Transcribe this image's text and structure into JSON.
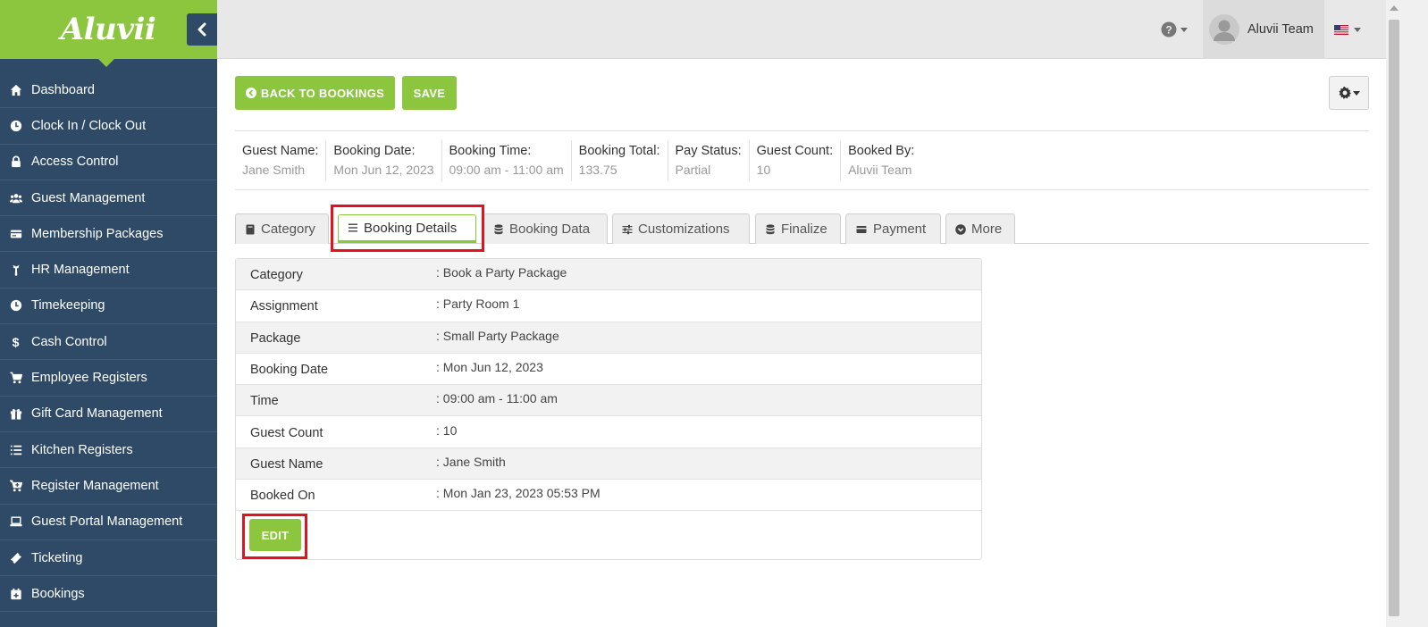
{
  "brand": {
    "logo_text": "Aluvii",
    "accent": "#8cc63f",
    "sidebar_bg": "#2e4a66"
  },
  "sidebar": {
    "items": [
      {
        "label": "Dashboard",
        "icon": "home-icon"
      },
      {
        "label": "Clock In / Clock Out",
        "icon": "clock-icon"
      },
      {
        "label": "Access Control",
        "icon": "lock-icon"
      },
      {
        "label": "Guest Management",
        "icon": "users-icon"
      },
      {
        "label": "Membership Packages",
        "icon": "card-icon"
      },
      {
        "label": "HR Management",
        "icon": "person-tie-icon"
      },
      {
        "label": "Timekeeping",
        "icon": "clock-icon"
      },
      {
        "label": "Cash Control",
        "icon": "dollar-icon"
      },
      {
        "label": "Employee Registers",
        "icon": "cart-icon"
      },
      {
        "label": "Gift Card Management",
        "icon": "gift-icon"
      },
      {
        "label": "Kitchen Registers",
        "icon": "list-icon"
      },
      {
        "label": "Register Management",
        "icon": "cart-plus-icon"
      },
      {
        "label": "Guest Portal Management",
        "icon": "laptop-icon"
      },
      {
        "label": "Ticketing",
        "icon": "ticket-icon"
      },
      {
        "label": "Bookings",
        "icon": "calendar-plus-icon"
      }
    ]
  },
  "topbar": {
    "user_name": "Aluvii Team",
    "help_icon": "question-circle-icon",
    "language_flag": "us-flag-icon"
  },
  "toolbar": {
    "back_label": "BACK TO BOOKINGS",
    "save_label": "SAVE"
  },
  "summary": [
    {
      "label": "Guest Name:",
      "value": "Jane Smith"
    },
    {
      "label": "Booking Date:",
      "value": "Mon Jun 12, 2023"
    },
    {
      "label": "Booking Time:",
      "value": "09:00 am - 11:00 am"
    },
    {
      "label": "Booking Total:",
      "value": "133.75"
    },
    {
      "label": "Pay Status:",
      "value": "Partial"
    },
    {
      "label": "Guest Count:",
      "value": "10"
    },
    {
      "label": "Booked By:",
      "value": "Aluvii Team"
    }
  ],
  "tabs": [
    {
      "label": "Category",
      "icon": "book-icon"
    },
    {
      "label": "Booking Details",
      "icon": "list-icon",
      "active": true
    },
    {
      "label": "Booking Data",
      "icon": "database-icon"
    },
    {
      "label": "Customizations",
      "icon": "sliders-icon"
    },
    {
      "label": "Finalize",
      "icon": "database-icon"
    },
    {
      "label": "Payment",
      "icon": "credit-card-icon"
    },
    {
      "label": "More",
      "icon": "chevron-circle-down-icon"
    }
  ],
  "details": {
    "rows": [
      {
        "label": "Category",
        "value": ": Book a Party Package"
      },
      {
        "label": "Assignment",
        "value": ": Party Room 1"
      },
      {
        "label": "Package",
        "value": ": Small Party Package"
      },
      {
        "label": "Booking Date",
        "value": ": Mon Jun 12, 2023"
      },
      {
        "label": "Time",
        "value": ": 09:00 am - 11:00 am"
      },
      {
        "label": "Guest Count",
        "value": ": 10"
      },
      {
        "label": "Guest Name",
        "value": ": Jane Smith"
      },
      {
        "label": "Booked On",
        "value": ": Mon Jan 23, 2023 05:53 PM"
      }
    ],
    "edit_label": "EDIT"
  },
  "highlight_color": "#e2131e"
}
